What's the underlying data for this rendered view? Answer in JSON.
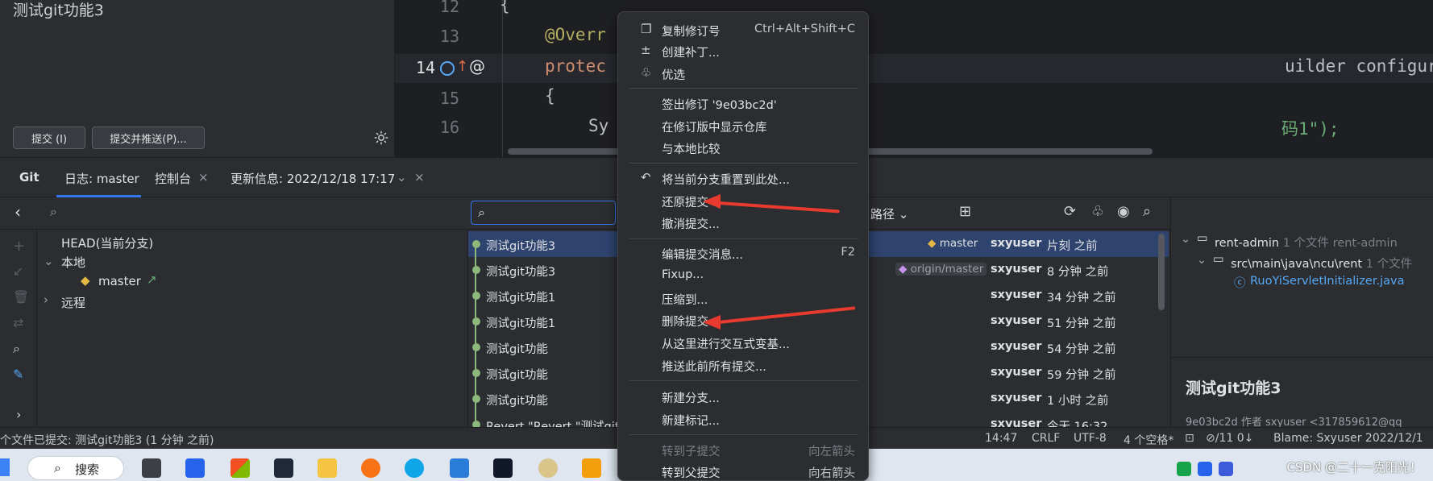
{
  "commit_panel": {
    "message": "测试git功能3",
    "commit_button": "提交 (I)",
    "commit_push_button": "提交并推送(P)..."
  },
  "editor": {
    "lines": [
      {
        "num": "12",
        "code": "{"
      },
      {
        "num": "13",
        "code": "@Overr"
      },
      {
        "num": "14",
        "code": "protec"
      },
      {
        "num": "15",
        "code": "{"
      },
      {
        "num": "16",
        "code": "Sy"
      }
    ],
    "line14_tail": "uilder configure(SpringApplicationBuilder applicati",
    "line16_tail": "码1\");",
    "gutter_at": "@"
  },
  "git_tabs": {
    "git": "Git",
    "log": "日志: master",
    "console": "控制台",
    "update_info": "更新信息: 2022/12/18 17:17"
  },
  "toolbar": {
    "path_filter": "路径"
  },
  "branch_tree": {
    "head": "HEAD(当前分支)",
    "local": "本地",
    "master": "master",
    "remote": "远程"
  },
  "log_rows": [
    {
      "msg": "测试git功能3",
      "tag": "master",
      "author": "sxyuser",
      "date": "片刻 之前"
    },
    {
      "msg": "测试git功能3",
      "tag": "origin/master",
      "author": "sxyuser",
      "date": "8 分钟 之前"
    },
    {
      "msg": "测试git功能1",
      "tag": "",
      "author": "sxyuser",
      "date": "34 分钟 之前"
    },
    {
      "msg": "测试git功能1",
      "tag": "",
      "author": "sxyuser",
      "date": "51 分钟 之前"
    },
    {
      "msg": "测试git功能",
      "tag": "",
      "author": "sxyuser",
      "date": "54 分钟 之前"
    },
    {
      "msg": "测试git功能",
      "tag": "",
      "author": "sxyuser",
      "date": "59 分钟 之前"
    },
    {
      "msg": "测试git功能",
      "tag": "",
      "author": "sxyuser",
      "date": "1 小时 之前"
    },
    {
      "msg": "Revert \"Revert \"测试git",
      "tag": "",
      "author": "sxyuser",
      "date": "今天 16:32"
    }
  ],
  "details": {
    "module": "rent-admin",
    "module_files": "1 个文件",
    "module_path": "rent-admin",
    "folder": "src\\main\\java\\ncu\\rent",
    "folder_files": "1 个文件",
    "file": "RuoYiServletInitializer.java",
    "commit_title": "测试git功能3",
    "commit_meta": "9e03bc2d 作者 sxyuser <317859612@qq"
  },
  "context_menu": {
    "items": [
      {
        "label": "复制修订号",
        "shortcut": "Ctrl+Alt+Shift+C",
        "icon": "copy-icon"
      },
      {
        "label": "创建补丁...",
        "shortcut": "",
        "icon": "patch-icon"
      },
      {
        "label": "优选",
        "shortcut": "",
        "icon": "cherry-pick-icon"
      },
      {
        "label": "签出修订 '9e03bc2d'",
        "shortcut": "",
        "icon": ""
      },
      {
        "label": "在修订版中显示仓库",
        "shortcut": "",
        "icon": ""
      },
      {
        "label": "与本地比较",
        "shortcut": "",
        "icon": ""
      },
      {
        "label": "将当前分支重置到此处...",
        "shortcut": "",
        "icon": "reset-icon"
      },
      {
        "label": "还原提交",
        "shortcut": "",
        "icon": ""
      },
      {
        "label": "撤消提交...",
        "shortcut": "",
        "icon": ""
      },
      {
        "label": "编辑提交消息...",
        "shortcut": "F2",
        "icon": ""
      },
      {
        "label": "Fixup...",
        "shortcut": "",
        "icon": ""
      },
      {
        "label": "压缩到...",
        "shortcut": "",
        "icon": ""
      },
      {
        "label": "删除提交",
        "shortcut": "",
        "icon": ""
      },
      {
        "label": "从这里进行交互式变基...",
        "shortcut": "",
        "icon": ""
      },
      {
        "label": "推送此前所有提交...",
        "shortcut": "",
        "icon": ""
      },
      {
        "label": "新建分支...",
        "shortcut": "",
        "icon": ""
      },
      {
        "label": "新建标记...",
        "shortcut": "",
        "icon": ""
      },
      {
        "label": "转到子提交",
        "shortcut": "向左箭头",
        "icon": ""
      },
      {
        "label": "转到父提交",
        "shortcut": "向右箭头",
        "icon": ""
      }
    ]
  },
  "statusbar": {
    "left": "个文件已提交: 测试git功能3 (1 分钟 之前)",
    "position": "14:47",
    "line_sep": "CRLF",
    "encoding": "UTF-8",
    "indent": "4 个空格*",
    "git_info": "⊘/11 0↓",
    "blame": "Blame: Sxyuser 2022/12/1"
  },
  "taskbar": {
    "search": "搜索",
    "watermark": "CSDN @二十一克阳光！"
  },
  "colors": {
    "accent": "#3574f0",
    "selection": "#2e436e",
    "graph": "#8cb87b",
    "annotation_arrow": "#e83a2f"
  }
}
